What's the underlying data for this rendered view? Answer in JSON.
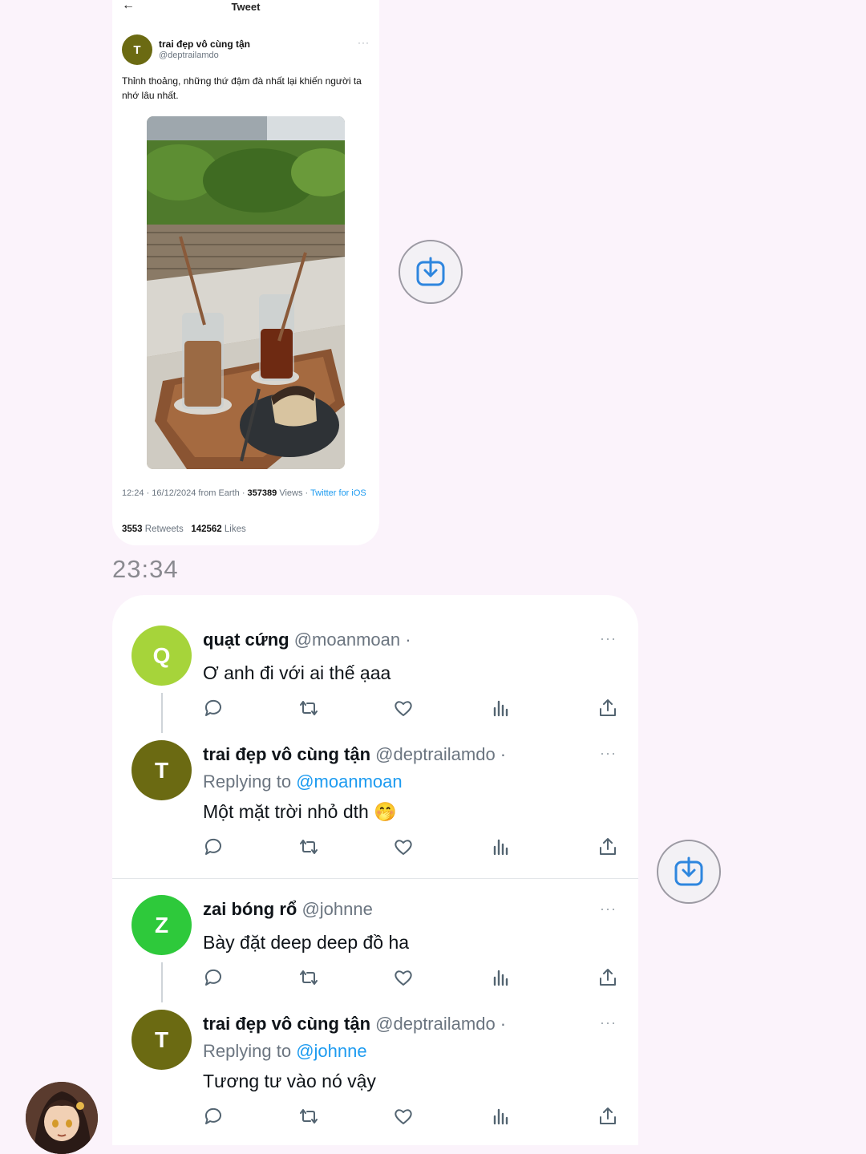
{
  "tweet_screenshot": {
    "header_title": "Tweet",
    "author_name": "trai đẹp vô cùng tận",
    "author_handle": "@deptrailamdo",
    "avatar_letter": "T",
    "text": "Thỉnh thoảng, những thứ đậm đà nhất lại khiến người ta nhớ lâu nhất.",
    "meta_time": "12:24 · 16/12/2024 from Earth ·",
    "meta_views_count": "357389",
    "meta_views_label": "Views ·",
    "meta_source": "Twitter for iOS",
    "retweets_count": "3553",
    "retweets_label": "Retweets",
    "likes_count": "142562",
    "likes_label": "Likes"
  },
  "timestamp": "23:34",
  "replies": [
    {
      "avatar_letter": "Q",
      "avatar_color": "#a6d43a",
      "name": "quạt cứng",
      "handle": "@moanmoan ·",
      "replying_label": "",
      "replying_to": "",
      "text": "Ơ anh đi với ai thế ạaa"
    },
    {
      "avatar_letter": "T",
      "avatar_color": "#6b6a12",
      "name": "trai đẹp vô cùng tận",
      "handle": "@deptrailamdo ·",
      "replying_label": "Replying to",
      "replying_to": "@moanmoan",
      "text": "Một mặt trời nhỏ dth 🤭"
    },
    {
      "avatar_letter": "Z",
      "avatar_color": "#2ec93b",
      "name": "zai bóng rổ",
      "handle": "@johnne",
      "replying_label": "",
      "replying_to": "",
      "text": "Bày đặt deep deep đồ ha"
    },
    {
      "avatar_letter": "T",
      "avatar_color": "#6b6a12",
      "name": "trai đẹp vô cùng tận",
      "handle": "@deptrailamdo ·",
      "replying_label": "Replying to",
      "replying_to": "@johnne",
      "text": "Tương tư vào nó vậy"
    }
  ],
  "icons": {
    "reply": "speech-bubble-icon",
    "retweet": "retweet-icon",
    "like": "heart-icon",
    "views": "bar-chart-icon",
    "share": "share-icon",
    "save": "download-icon"
  },
  "colors": {
    "background": "#fbf3fb",
    "link": "#1d9bf0",
    "save_icon": "#2e86de"
  }
}
